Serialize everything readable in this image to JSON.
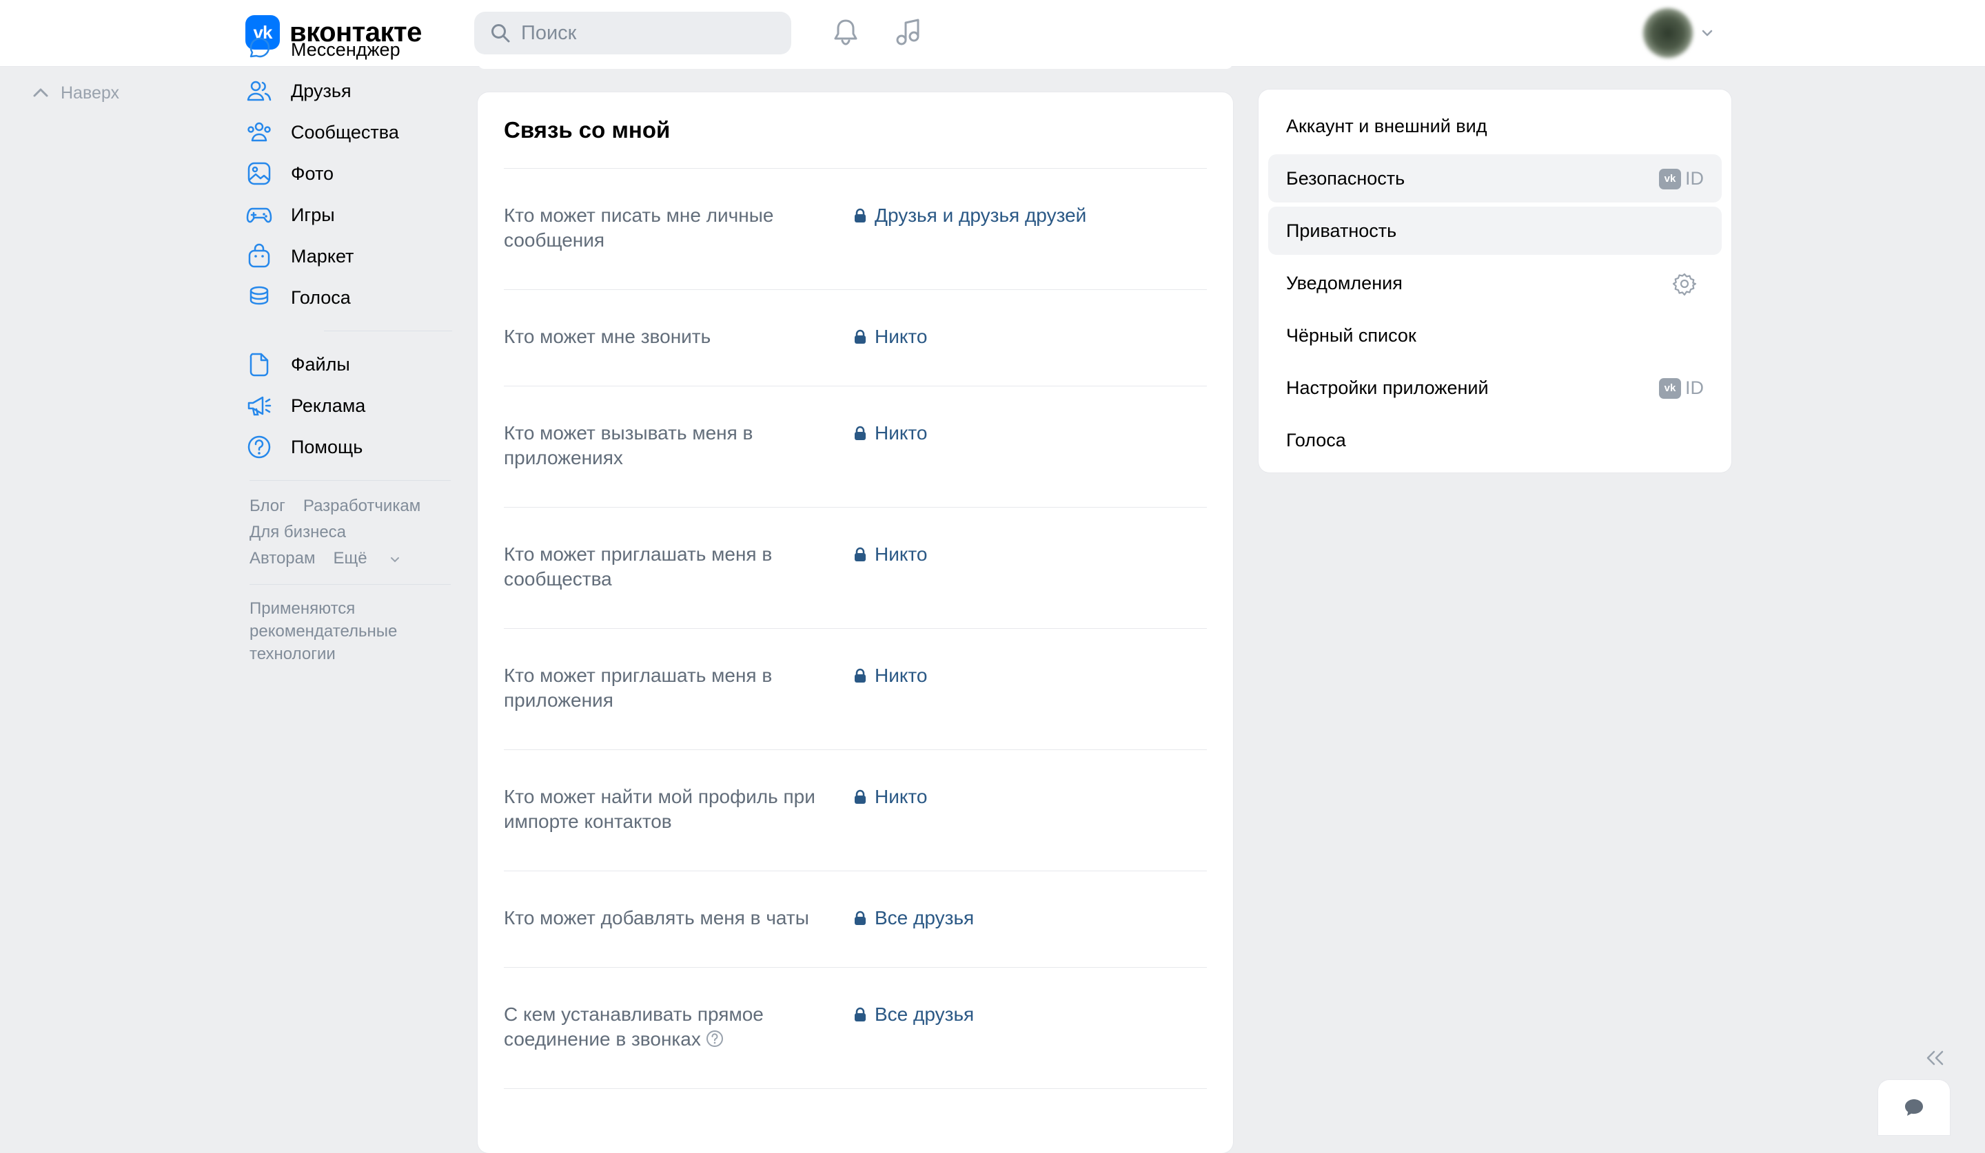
{
  "header": {
    "logo_mark": "vk",
    "logo_text": "вконтакте",
    "search_placeholder": "Поиск",
    "icons": [
      "bell-icon",
      "music-icon"
    ]
  },
  "scroll_up": {
    "label": "Наверх"
  },
  "sidebar": {
    "items": [
      {
        "label": "Мессенджер",
        "icon": "message-icon"
      },
      {
        "label": "Друзья",
        "icon": "friends-icon"
      },
      {
        "label": "Сообщества",
        "icon": "communities-icon"
      },
      {
        "label": "Фото",
        "icon": "photo-icon"
      },
      {
        "label": "Игры",
        "icon": "gamepad-icon"
      },
      {
        "label": "Маркет",
        "icon": "market-bag-icon"
      },
      {
        "label": "Голоса",
        "icon": "coins-icon"
      }
    ],
    "secondary": [
      {
        "label": "Файлы",
        "icon": "file-icon"
      },
      {
        "label": "Реклама",
        "icon": "megaphone-icon"
      },
      {
        "label": "Помощь",
        "icon": "help-icon"
      }
    ],
    "footer_links": [
      "Блог",
      "Разработчикам",
      "Для бизнеса",
      "Авторам",
      "Ещё"
    ],
    "recommend_note": "Применяются рекомендательные технологии"
  },
  "main": {
    "section_title": "Связь со мной",
    "rows": [
      {
        "label": "Кто может писать мне личные сообщения",
        "value": "Друзья и друзья друзей"
      },
      {
        "label": "Кто может мне звонить",
        "value": "Никто"
      },
      {
        "label": "Кто может вызывать меня в приложениях",
        "value": "Никто"
      },
      {
        "label": "Кто может приглашать меня в сообщества",
        "value": "Никто"
      },
      {
        "label": "Кто может приглашать меня в приложения",
        "value": "Никто"
      },
      {
        "label": "Кто может найти мой профиль при импорте контактов",
        "value": "Никто"
      },
      {
        "label": "Кто может добавлять меня в чаты",
        "value": "Все друзья"
      },
      {
        "label": "С кем устанавливать прямое соединение в звонках",
        "value": "Все друзья",
        "has_help": true
      }
    ]
  },
  "settings_menu": {
    "items": [
      {
        "label": "Аккаунт и внешний вид"
      },
      {
        "label": "Безопасность",
        "badge": "ID",
        "highlighted": true
      },
      {
        "label": "Приватность",
        "selected": true
      },
      {
        "label": "Уведомления",
        "icon": "gear-icon"
      },
      {
        "label": "Чёрный список"
      },
      {
        "label": "Настройки приложений",
        "badge": "ID"
      },
      {
        "label": "Голоса"
      }
    ]
  },
  "colors": {
    "accent": "#0077ff",
    "link": "#2a5885",
    "background": "#edeef0",
    "muted_text": "#818c99"
  }
}
